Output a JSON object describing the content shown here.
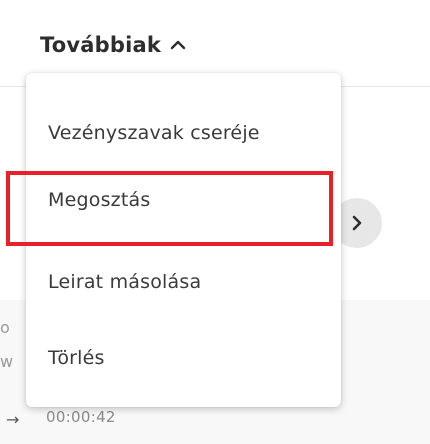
{
  "toolbar": {
    "more_label": "Továbbiak"
  },
  "dropdown": {
    "items": [
      {
        "label": "Vezényszavak cseréje"
      },
      {
        "label": "Megosztás"
      },
      {
        "label": "Leirat másolása"
      },
      {
        "label": "Törlés"
      }
    ],
    "highlighted_item": "Megosztás"
  },
  "background": {
    "fragment_1": "o",
    "fragment_2": "w",
    "time": "00:00:42"
  },
  "icons": {
    "more_toggle": "chevron-up-icon",
    "next": "chevron-right-icon",
    "row": "arrow-right-icon"
  },
  "colors": {
    "highlight": "#e8202a",
    "menu_background": "#ffffff",
    "circle_button": "#e7e7e7"
  }
}
